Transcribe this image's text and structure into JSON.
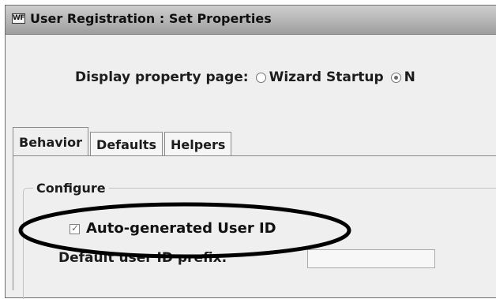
{
  "window": {
    "title": "User Registration : Set Properties",
    "icon_text": "WF"
  },
  "display_property_page": {
    "label": "Display property page:",
    "options": [
      {
        "label": "Wizard Startup",
        "selected": false
      },
      {
        "label": "N",
        "selected": true
      }
    ]
  },
  "tabs": [
    {
      "label": "Behavior",
      "active": true
    },
    {
      "label": "Defaults",
      "active": false
    },
    {
      "label": "Helpers",
      "active": false
    }
  ],
  "configure": {
    "title": "Configure",
    "auto_generated_user_id": {
      "label": "Auto-generated User ID",
      "checked": true
    },
    "default_prefix": {
      "label": "Default user ID prefix:",
      "value": "",
      "placeholder": ""
    }
  },
  "icons": {
    "app": "application-icon",
    "checkmark": "checkmark-icon"
  }
}
